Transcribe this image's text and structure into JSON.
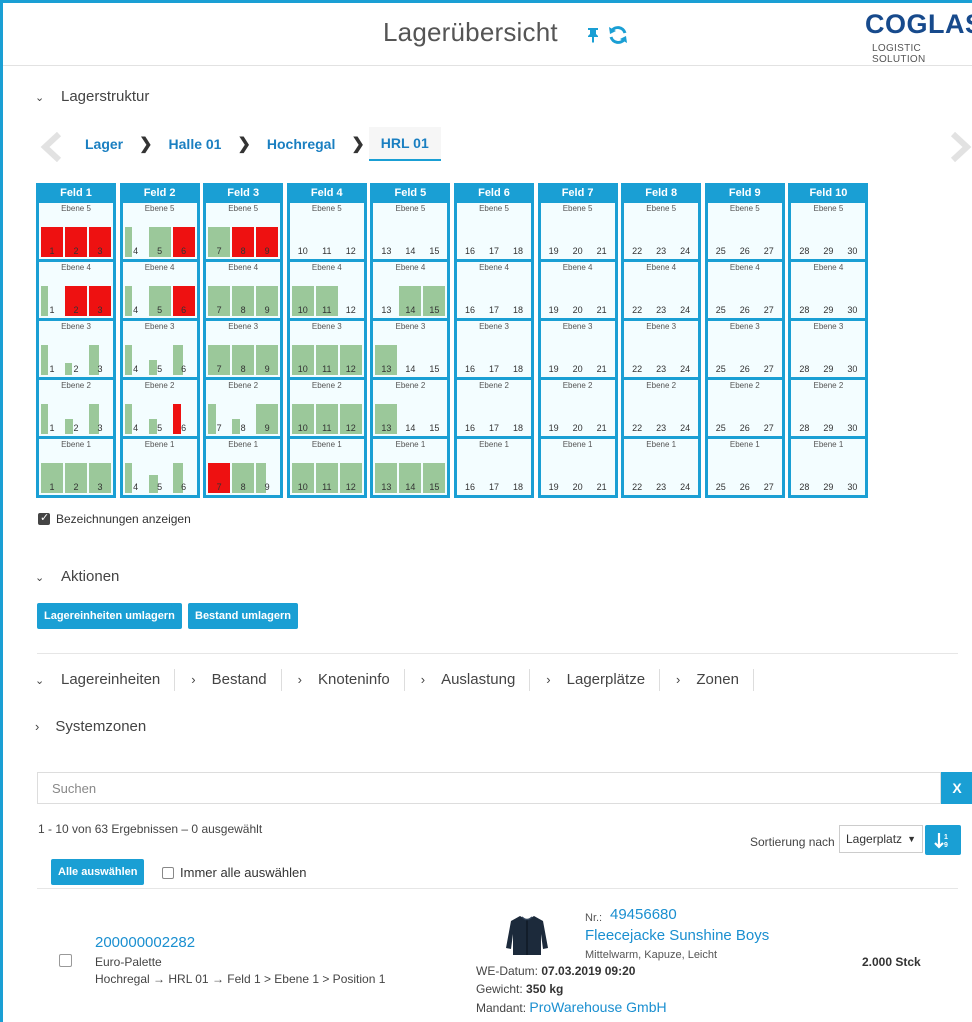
{
  "header": {
    "title": "Lagerübersicht",
    "pin_icon": "pin-icon",
    "refresh_icon": "refresh-icon",
    "logo_main": "COGLAS",
    "logo_sub": "LOGISTIC SOLUTION",
    "brand_color": "#174a8c",
    "accent_color": "#1a9fd4"
  },
  "structure": {
    "section_label": "Lagerstruktur",
    "breadcrumb": [
      "Lager",
      "Halle 01",
      "Hochregal",
      "HRL 01"
    ],
    "show_labels_checkbox": "Bezeichnungen anzeigen",
    "show_labels_checked": true
  },
  "rack": {
    "fields": [
      {
        "name": "Feld 1",
        "levels": {
          "5": [
            {
              "n": "1",
              "f": 1,
              "r": true
            },
            {
              "n": "2",
              "f": 1,
              "r": true
            },
            {
              "n": "3",
              "f": 1,
              "r": true
            }
          ],
          "4": [
            {
              "n": "1",
              "f": 1,
              "r": false,
              "w": 0.3
            },
            {
              "n": "2",
              "f": 1,
              "r": true
            },
            {
              "n": "3",
              "f": 1,
              "r": true
            }
          ],
          "3": [
            {
              "n": "1",
              "f": 1,
              "r": false,
              "w": 0.3
            },
            {
              "n": "2",
              "f": 0.4,
              "r": false,
              "w": 0.3
            },
            {
              "n": "3",
              "f": 1,
              "r": false,
              "w": 0.45
            }
          ],
          "2": [
            {
              "n": "1",
              "f": 1,
              "r": false,
              "w": 0.3
            },
            {
              "n": "2",
              "f": 0.5,
              "r": false,
              "w": 0.35
            },
            {
              "n": "3",
              "f": 1,
              "r": false,
              "w": 0.45
            }
          ],
          "1": [
            {
              "n": "1",
              "f": 1,
              "r": false
            },
            {
              "n": "2",
              "f": 1,
              "r": false
            },
            {
              "n": "3",
              "f": 1,
              "r": false
            }
          ]
        }
      },
      {
        "name": "Feld 2",
        "levels": {
          "5": [
            {
              "n": "4",
              "f": 1,
              "r": false,
              "w": 0.3
            },
            {
              "n": "5",
              "f": 1,
              "r": false
            },
            {
              "n": "6",
              "f": 1,
              "r": true
            }
          ],
          "4": [
            {
              "n": "4",
              "f": 1,
              "r": false,
              "w": 0.3
            },
            {
              "n": "5",
              "f": 1,
              "r": false
            },
            {
              "n": "6",
              "f": 1,
              "r": true
            }
          ],
          "3": [
            {
              "n": "4",
              "f": 1,
              "r": false,
              "w": 0.3
            },
            {
              "n": "5",
              "f": 0.5,
              "r": false,
              "w": 0.35
            },
            {
              "n": "6",
              "f": 1,
              "r": false,
              "w": 0.45
            }
          ],
          "2": [
            {
              "n": "4",
              "f": 1,
              "r": false,
              "w": 0.3
            },
            {
              "n": "5",
              "f": 0.5,
              "r": false,
              "w": 0.35
            },
            {
              "n": "6",
              "f": 1,
              "r": true,
              "w": 0.35
            }
          ],
          "1": [
            {
              "n": "4",
              "f": 1,
              "r": false,
              "w": 0.3
            },
            {
              "n": "5",
              "f": 0.6,
              "r": false,
              "w": 0.4
            },
            {
              "n": "6",
              "f": 1,
              "r": false,
              "w": 0.45
            }
          ]
        }
      },
      {
        "name": "Feld 3",
        "levels": {
          "5": [
            {
              "n": "7",
              "f": 1,
              "r": false
            },
            {
              "n": "8",
              "f": 1,
              "r": true
            },
            {
              "n": "9",
              "f": 1,
              "r": true
            }
          ],
          "4": [
            {
              "n": "7",
              "f": 1,
              "r": false
            },
            {
              "n": "8",
              "f": 1,
              "r": false
            },
            {
              "n": "9",
              "f": 1,
              "r": false
            }
          ],
          "3": [
            {
              "n": "7",
              "f": 1,
              "r": false
            },
            {
              "n": "8",
              "f": 1,
              "r": false
            },
            {
              "n": "9",
              "f": 1,
              "r": false
            }
          ],
          "2": [
            {
              "n": "7",
              "f": 1,
              "r": false,
              "w": 0.35
            },
            {
              "n": "8",
              "f": 0.5,
              "r": false,
              "w": 0.35
            },
            {
              "n": "9",
              "f": 1,
              "r": false
            }
          ],
          "1": [
            {
              "n": "7",
              "f": 1,
              "r": true
            },
            {
              "n": "8",
              "f": 1,
              "r": false
            },
            {
              "n": "9",
              "f": 1,
              "r": false,
              "w": 0.45
            }
          ]
        }
      },
      {
        "name": "Feld 4",
        "levels": {
          "5": [
            {
              "n": "10",
              "f": 0
            },
            {
              "n": "11",
              "f": 0
            },
            {
              "n": "12",
              "f": 0
            }
          ],
          "4": [
            {
              "n": "10",
              "f": 1,
              "r": false
            },
            {
              "n": "11",
              "f": 1,
              "r": false
            },
            {
              "n": "12",
              "f": 0
            }
          ],
          "3": [
            {
              "n": "10",
              "f": 1,
              "r": false
            },
            {
              "n": "11",
              "f": 1,
              "r": false
            },
            {
              "n": "12",
              "f": 1,
              "r": false
            }
          ],
          "2": [
            {
              "n": "10",
              "f": 1,
              "r": false
            },
            {
              "n": "11",
              "f": 1,
              "r": false
            },
            {
              "n": "12",
              "f": 1,
              "r": false
            }
          ],
          "1": [
            {
              "n": "10",
              "f": 1,
              "r": false
            },
            {
              "n": "11",
              "f": 1,
              "r": false
            },
            {
              "n": "12",
              "f": 1,
              "r": false
            }
          ]
        }
      },
      {
        "name": "Feld 5",
        "levels": {
          "5": [
            {
              "n": "13",
              "f": 0
            },
            {
              "n": "14",
              "f": 0
            },
            {
              "n": "15",
              "f": 0
            }
          ],
          "4": [
            {
              "n": "13",
              "f": 0
            },
            {
              "n": "14",
              "f": 1,
              "r": false
            },
            {
              "n": "15",
              "f": 1,
              "r": false
            }
          ],
          "3": [
            {
              "n": "13",
              "f": 1,
              "r": false
            },
            {
              "n": "14",
              "f": 0
            },
            {
              "n": "15",
              "f": 0
            }
          ],
          "2": [
            {
              "n": "13",
              "f": 1,
              "r": false
            },
            {
              "n": "14",
              "f": 0
            },
            {
              "n": "15",
              "f": 0
            }
          ],
          "1": [
            {
              "n": "13",
              "f": 1,
              "r": false
            },
            {
              "n": "14",
              "f": 1,
              "r": false
            },
            {
              "n": "15",
              "f": 1,
              "r": false
            }
          ]
        }
      },
      {
        "name": "Feld 6",
        "levels": {
          "5": [
            {
              "n": "16",
              "f": 0
            },
            {
              "n": "17",
              "f": 0
            },
            {
              "n": "18",
              "f": 0
            }
          ],
          "4": [
            {
              "n": "16",
              "f": 0
            },
            {
              "n": "17",
              "f": 0
            },
            {
              "n": "18",
              "f": 0
            }
          ],
          "3": [
            {
              "n": "16",
              "f": 0
            },
            {
              "n": "17",
              "f": 0
            },
            {
              "n": "18",
              "f": 0
            }
          ],
          "2": [
            {
              "n": "16",
              "f": 0
            },
            {
              "n": "17",
              "f": 0
            },
            {
              "n": "18",
              "f": 0
            }
          ],
          "1": [
            {
              "n": "16",
              "f": 0
            },
            {
              "n": "17",
              "f": 0
            },
            {
              "n": "18",
              "f": 0
            }
          ]
        }
      },
      {
        "name": "Feld 7",
        "levels": {
          "5": [
            {
              "n": "19",
              "f": 0
            },
            {
              "n": "20",
              "f": 0
            },
            {
              "n": "21",
              "f": 0
            }
          ],
          "4": [
            {
              "n": "19",
              "f": 0
            },
            {
              "n": "20",
              "f": 0
            },
            {
              "n": "21",
              "f": 0
            }
          ],
          "3": [
            {
              "n": "19",
              "f": 0
            },
            {
              "n": "20",
              "f": 0
            },
            {
              "n": "21",
              "f": 0
            }
          ],
          "2": [
            {
              "n": "19",
              "f": 0
            },
            {
              "n": "20",
              "f": 0
            },
            {
              "n": "21",
              "f": 0
            }
          ],
          "1": [
            {
              "n": "19",
              "f": 0
            },
            {
              "n": "20",
              "f": 0
            },
            {
              "n": "21",
              "f": 0
            }
          ]
        }
      },
      {
        "name": "Feld 8",
        "levels": {
          "5": [
            {
              "n": "22",
              "f": 0
            },
            {
              "n": "23",
              "f": 0
            },
            {
              "n": "24",
              "f": 0
            }
          ],
          "4": [
            {
              "n": "22",
              "f": 0
            },
            {
              "n": "23",
              "f": 0
            },
            {
              "n": "24",
              "f": 0
            }
          ],
          "3": [
            {
              "n": "22",
              "f": 0
            },
            {
              "n": "23",
              "f": 0
            },
            {
              "n": "24",
              "f": 0
            }
          ],
          "2": [
            {
              "n": "22",
              "f": 0
            },
            {
              "n": "23",
              "f": 0
            },
            {
              "n": "24",
              "f": 0
            }
          ],
          "1": [
            {
              "n": "22",
              "f": 0
            },
            {
              "n": "23",
              "f": 0
            },
            {
              "n": "24",
              "f": 0
            }
          ]
        }
      },
      {
        "name": "Feld 9",
        "levels": {
          "5": [
            {
              "n": "25",
              "f": 0
            },
            {
              "n": "26",
              "f": 0
            },
            {
              "n": "27",
              "f": 0
            }
          ],
          "4": [
            {
              "n": "25",
              "f": 0
            },
            {
              "n": "26",
              "f": 0
            },
            {
              "n": "27",
              "f": 0
            }
          ],
          "3": [
            {
              "n": "25",
              "f": 0
            },
            {
              "n": "26",
              "f": 0
            },
            {
              "n": "27",
              "f": 0
            }
          ],
          "2": [
            {
              "n": "25",
              "f": 0
            },
            {
              "n": "26",
              "f": 0
            },
            {
              "n": "27",
              "f": 0
            }
          ],
          "1": [
            {
              "n": "25",
              "f": 0
            },
            {
              "n": "26",
              "f": 0
            },
            {
              "n": "27",
              "f": 0
            }
          ]
        }
      },
      {
        "name": "Feld 10",
        "levels": {
          "5": [
            {
              "n": "28",
              "f": 0
            },
            {
              "n": "29",
              "f": 0
            },
            {
              "n": "30",
              "f": 0
            }
          ],
          "4": [
            {
              "n": "28",
              "f": 0
            },
            {
              "n": "29",
              "f": 0
            },
            {
              "n": "30",
              "f": 0
            }
          ],
          "3": [
            {
              "n": "28",
              "f": 0
            },
            {
              "n": "29",
              "f": 0
            },
            {
              "n": "30",
              "f": 0
            }
          ],
          "2": [
            {
              "n": "28",
              "f": 0
            },
            {
              "n": "29",
              "f": 0
            },
            {
              "n": "30",
              "f": 0
            }
          ],
          "1": [
            {
              "n": "28",
              "f": 0
            },
            {
              "n": "29",
              "f": 0
            },
            {
              "n": "30",
              "f": 0
            }
          ]
        }
      }
    ],
    "level_prefix": "Ebene",
    "colors": {
      "occupied": "#9bc89a",
      "blocked": "#ee1111",
      "cell_bg": "#f3fdff",
      "frame": "#1a9fd4"
    }
  },
  "actions": {
    "section_label": "Aktionen",
    "btn_move_units": "Lagereinheiten umlagern",
    "btn_move_stock": "Bestand umlagern"
  },
  "tabs": [
    "Lagereinheiten",
    "Bestand",
    "Knoteninfo",
    "Auslastung",
    "Lagerplätze",
    "Zonen"
  ],
  "system_zones": "Systemzonen",
  "search": {
    "placeholder": "Suchen",
    "clear_label": "X"
  },
  "results": {
    "summary": "1 - 10 von 63 Ergebnissen  –  0 ausgewählt",
    "sort_label": "Sortierung nach",
    "sort_value": "Lagerplatz",
    "select_all_btn": "Alle auswählen",
    "always_select_all": "Immer alle auswählen"
  },
  "item": {
    "id": "200000002282",
    "type": "Euro-Palette",
    "path": "Hochregal → HRL 01 → Feld 1 > Ebene 1 > Position 1",
    "nr_label": "Nr.:",
    "nr": "49456680",
    "article_name": "Fleecejacke Sunshine Boys",
    "article_desc": "Mittelwarm, Kapuze, Leicht",
    "we_label": "WE-Datum:",
    "we_value": "07.03.2019 09:20",
    "weight_label": "Gewicht:",
    "weight_value": "350 kg",
    "client_label": "Mandant:",
    "client_value": "ProWarehouse GmbH",
    "quantity": "2.000 Stck",
    "icon": "jacket-icon"
  }
}
